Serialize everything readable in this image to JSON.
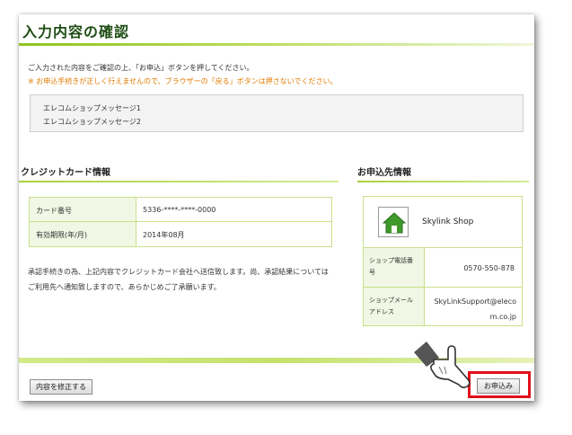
{
  "page": {
    "title": "入力内容の確認",
    "intro": "ご入力された内容をご確認の上、「お申込」ボタンを押してください。",
    "warning": "※ お申込手続きが正しく行えませんので、ブラウザーの「戻る」ボタンは押さないでください。"
  },
  "messages": [
    "エレコムショップメッセージ1",
    "エレコムショップメッセージ2"
  ],
  "card_section": {
    "title": "クレジットカード情報",
    "rows": [
      {
        "label": "カード番号",
        "value": "5336-****-****-0000"
      },
      {
        "label": "有効期限(年/月)",
        "value": "2014年08月"
      }
    ],
    "note_line1": "承認手続きの為、上記内容でクレジットカード会社へ送信致します。尚、承認結果については",
    "note_line2": "ご利用先へ通知致しますので、あらかじめご了承願います。"
  },
  "shop_section": {
    "title": "お申込先情報",
    "shop_name": "Skylink  Shop",
    "tel_label_1": "ショップ電話番",
    "tel_label_2": "号",
    "tel_value": "0570-550-878",
    "mail_label_1": "ショップメール",
    "mail_label_2": "アドレス",
    "mail_value_1": "SkyLinkSupport@eleco",
    "mail_value_2": "m.co.jp"
  },
  "buttons": {
    "edit": "内容を修正する",
    "apply": "お申込み"
  },
  "colors": {
    "accent_green": "#8fc31f",
    "title_green": "#1e4d14",
    "warning_orange": "#e07b00",
    "highlight_red": "#e0101a"
  },
  "icons": {
    "shop_logo": "house-icon",
    "cursor": "pointing-hand-icon"
  }
}
